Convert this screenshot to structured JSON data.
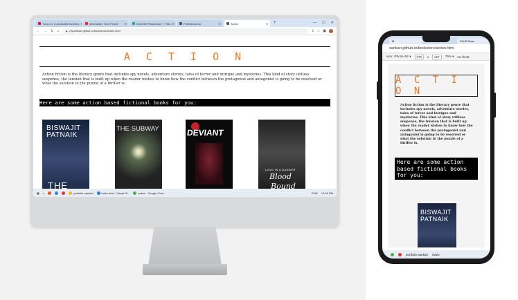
{
  "browser": {
    "tabs": [
      {
        "label": "Your-Lev | Unsuitable tanrines",
        "fav": "#d14"
      },
      {
        "label": "Minimalist / Nice Flower",
        "fav": "#e22"
      },
      {
        "label": "MUSHIS Passionate T+ Bla",
        "fav": "#2a8"
      },
      {
        "label": "Portfolio-anna",
        "fav": "#555"
      },
      {
        "label": "Action",
        "fav": "#555"
      }
    ],
    "url": "piyushkan.github.io/bookstore/action.html",
    "newtab_symbol": "+",
    "window_controls": [
      "—",
      "▢",
      "✕"
    ]
  },
  "page": {
    "title": "A C T I O N",
    "description": "Action fiction is the literary genre that includes spy novels, adventure stories, tales of terror and intrigue and mysteries. This kind of story utilizes suspense, the tension that is built up when the reader wishes to know how the conflict between the protagonist and antagonist is going to be resolved or what the solution to the puzzle of a thriller is.",
    "banner": "Here are some action based fictional books for you:",
    "books": [
      {
        "title_line1": "BISWAJIT",
        "title_line2": "PATNAIK",
        "subtitle": "THE VISION"
      },
      {
        "title_line1": "THE SUBWAY"
      },
      {
        "title_line1": "DEVIANT"
      },
      {
        "small": "LOVE IN A DANGER",
        "title_line1": "Blood",
        "title_line2": "Bound"
      }
    ]
  },
  "taskbar": {
    "items": [
      "portfolio-sankari",
      "index.html - Visual St...",
      "action - Google Chro..."
    ],
    "lang": "ENG",
    "time": "12:09 PM"
  },
  "phone": {
    "tab_label": "M",
    "tab_label2": "PLUS Roun",
    "url": "sankari.github.io/bookstore/action.html",
    "device": "ions: iPhone SE ▾",
    "width": "375",
    "height": "667",
    "zoom": "79% ▾",
    "throttle": "No thrott",
    "title": "A C T I O N",
    "description": "Action fiction is the literary genre that includes spy novels, adventure stories, tales of terror and intrigue and mysteries. This kind of story utilizes suspense, the tension that is built up when the reader wishes to know how the conflict between the protagonist and antagonist is going to be resolved or what the solution to the puzzle of a thriller is.",
    "banner": "Here are some action based fictional books for you:",
    "book_line1": "BISWAJIT",
    "book_line2": "PATNAIK",
    "taskbar_item": "portfolio-sankari",
    "taskbar_item2": "index"
  }
}
